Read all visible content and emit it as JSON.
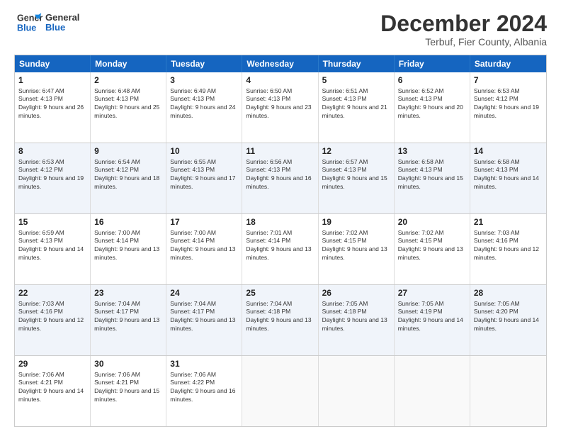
{
  "logo": {
    "text_general": "General",
    "text_blue": "Blue"
  },
  "header": {
    "month": "December 2024",
    "location": "Terbuf, Fier County, Albania"
  },
  "days": [
    "Sunday",
    "Monday",
    "Tuesday",
    "Wednesday",
    "Thursday",
    "Friday",
    "Saturday"
  ],
  "weeks": [
    [
      {
        "day": "1",
        "sunrise": "6:47 AM",
        "sunset": "4:13 PM",
        "daylight": "9 hours and 26 minutes."
      },
      {
        "day": "2",
        "sunrise": "6:48 AM",
        "sunset": "4:13 PM",
        "daylight": "9 hours and 25 minutes."
      },
      {
        "day": "3",
        "sunrise": "6:49 AM",
        "sunset": "4:13 PM",
        "daylight": "9 hours and 24 minutes."
      },
      {
        "day": "4",
        "sunrise": "6:50 AM",
        "sunset": "4:13 PM",
        "daylight": "9 hours and 23 minutes."
      },
      {
        "day": "5",
        "sunrise": "6:51 AM",
        "sunset": "4:13 PM",
        "daylight": "9 hours and 21 minutes."
      },
      {
        "day": "6",
        "sunrise": "6:52 AM",
        "sunset": "4:13 PM",
        "daylight": "9 hours and 20 minutes."
      },
      {
        "day": "7",
        "sunrise": "6:53 AM",
        "sunset": "4:12 PM",
        "daylight": "9 hours and 19 minutes."
      }
    ],
    [
      {
        "day": "8",
        "sunrise": "6:53 AM",
        "sunset": "4:12 PM",
        "daylight": "9 hours and 19 minutes."
      },
      {
        "day": "9",
        "sunrise": "6:54 AM",
        "sunset": "4:12 PM",
        "daylight": "9 hours and 18 minutes."
      },
      {
        "day": "10",
        "sunrise": "6:55 AM",
        "sunset": "4:13 PM",
        "daylight": "9 hours and 17 minutes."
      },
      {
        "day": "11",
        "sunrise": "6:56 AM",
        "sunset": "4:13 PM",
        "daylight": "9 hours and 16 minutes."
      },
      {
        "day": "12",
        "sunrise": "6:57 AM",
        "sunset": "4:13 PM",
        "daylight": "9 hours and 15 minutes."
      },
      {
        "day": "13",
        "sunrise": "6:58 AM",
        "sunset": "4:13 PM",
        "daylight": "9 hours and 15 minutes."
      },
      {
        "day": "14",
        "sunrise": "6:58 AM",
        "sunset": "4:13 PM",
        "daylight": "9 hours and 14 minutes."
      }
    ],
    [
      {
        "day": "15",
        "sunrise": "6:59 AM",
        "sunset": "4:13 PM",
        "daylight": "9 hours and 14 minutes."
      },
      {
        "day": "16",
        "sunrise": "7:00 AM",
        "sunset": "4:14 PM",
        "daylight": "9 hours and 13 minutes."
      },
      {
        "day": "17",
        "sunrise": "7:00 AM",
        "sunset": "4:14 PM",
        "daylight": "9 hours and 13 minutes."
      },
      {
        "day": "18",
        "sunrise": "7:01 AM",
        "sunset": "4:14 PM",
        "daylight": "9 hours and 13 minutes."
      },
      {
        "day": "19",
        "sunrise": "7:02 AM",
        "sunset": "4:15 PM",
        "daylight": "9 hours and 13 minutes."
      },
      {
        "day": "20",
        "sunrise": "7:02 AM",
        "sunset": "4:15 PM",
        "daylight": "9 hours and 13 minutes."
      },
      {
        "day": "21",
        "sunrise": "7:03 AM",
        "sunset": "4:16 PM",
        "daylight": "9 hours and 12 minutes."
      }
    ],
    [
      {
        "day": "22",
        "sunrise": "7:03 AM",
        "sunset": "4:16 PM",
        "daylight": "9 hours and 12 minutes."
      },
      {
        "day": "23",
        "sunrise": "7:04 AM",
        "sunset": "4:17 PM",
        "daylight": "9 hours and 13 minutes."
      },
      {
        "day": "24",
        "sunrise": "7:04 AM",
        "sunset": "4:17 PM",
        "daylight": "9 hours and 13 minutes."
      },
      {
        "day": "25",
        "sunrise": "7:04 AM",
        "sunset": "4:18 PM",
        "daylight": "9 hours and 13 minutes."
      },
      {
        "day": "26",
        "sunrise": "7:05 AM",
        "sunset": "4:18 PM",
        "daylight": "9 hours and 13 minutes."
      },
      {
        "day": "27",
        "sunrise": "7:05 AM",
        "sunset": "4:19 PM",
        "daylight": "9 hours and 14 minutes."
      },
      {
        "day": "28",
        "sunrise": "7:05 AM",
        "sunset": "4:20 PM",
        "daylight": "9 hours and 14 minutes."
      }
    ],
    [
      {
        "day": "29",
        "sunrise": "7:06 AM",
        "sunset": "4:21 PM",
        "daylight": "9 hours and 14 minutes."
      },
      {
        "day": "30",
        "sunrise": "7:06 AM",
        "sunset": "4:21 PM",
        "daylight": "9 hours and 15 minutes."
      },
      {
        "day": "31",
        "sunrise": "7:06 AM",
        "sunset": "4:22 PM",
        "daylight": "9 hours and 16 minutes."
      },
      null,
      null,
      null,
      null
    ]
  ]
}
